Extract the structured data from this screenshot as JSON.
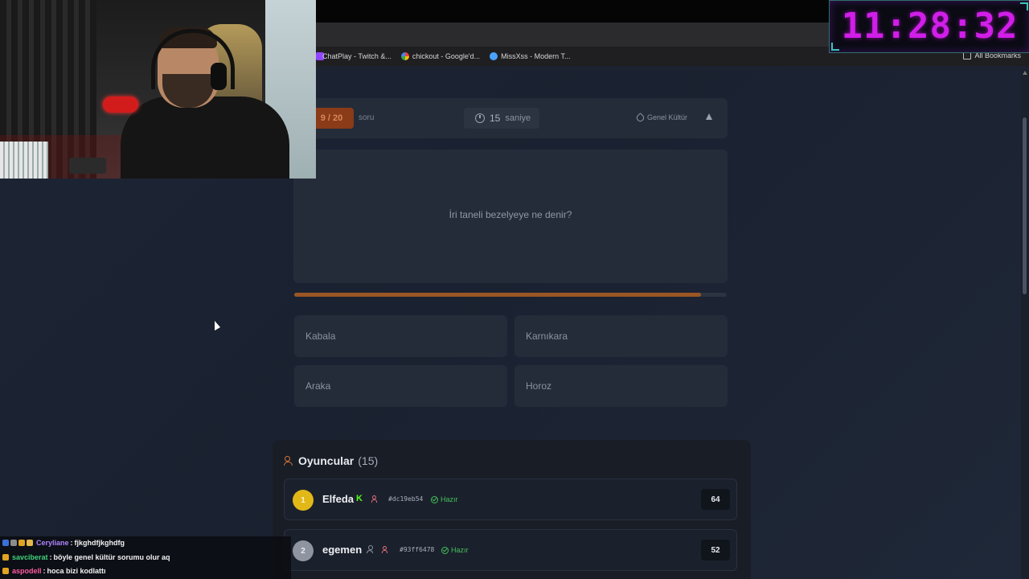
{
  "clock": {
    "time": "11:28:32"
  },
  "bookmarks": {
    "items": [
      {
        "label": "ChatPlay - Twitch &...",
        "icon": "twitch-icon",
        "color": "#9146ff"
      },
      {
        "label": "chickout - Google'd...",
        "icon": "google-icon",
        "color": "#ea4335"
      },
      {
        "label": "MissXss - Modern T...",
        "icon": "site-icon",
        "color": "#4aa3ff"
      }
    ],
    "all_label": "All Bookmarks"
  },
  "quiz": {
    "progress": "9 / 20",
    "progress_suffix": "soru",
    "timer_value": "15",
    "timer_unit": "saniye",
    "category": "Genel Kültür",
    "question": "İri taneli bezelyeye ne denir?",
    "time_remaining_fraction": 0.94,
    "answers": [
      "Kabala",
      "Karnıkara",
      "Araka",
      "Horoz"
    ],
    "accent_color": "#d9753a"
  },
  "players": {
    "title": "Oyuncular",
    "count_label": "(15)",
    "list": [
      {
        "rank": "1",
        "name": "Elfeda",
        "platform": "kick",
        "hash": "#dc19eb54",
        "status": "Hazır",
        "score": "64"
      },
      {
        "rank": "2",
        "name": "egemen",
        "platform": "user",
        "hash": "#93ff6478",
        "status": "Hazır",
        "score": "52"
      }
    ]
  },
  "chat": {
    "messages": [
      {
        "user": "Ceryliane",
        "sep": ":",
        "text": "fjkghdfjkghdfg",
        "user_color": "#b083ff"
      },
      {
        "user": "savciberat",
        "sep": ":",
        "text": "böyle genel kültür sorumu olur aq",
        "user_color": "#3fd17a"
      },
      {
        "user": "aspodell",
        "sep": ":",
        "text": "hoca bizi kodlattı",
        "user_color": "#ff5aa0"
      }
    ]
  }
}
